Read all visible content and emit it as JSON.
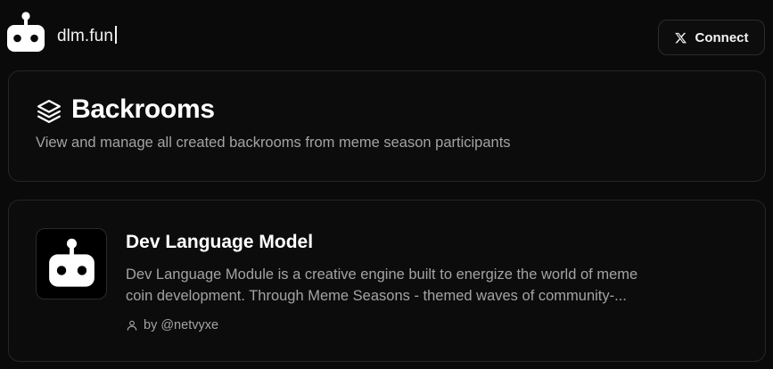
{
  "header": {
    "site_name": "dlm.fun",
    "connect_label": "Connect",
    "connect_icon": "x-logo-icon",
    "logo_icon": "robot-icon"
  },
  "page": {
    "title": "Backrooms",
    "title_icon": "layers-icon",
    "subtitle": "View and manage all created backrooms from meme season participants"
  },
  "backrooms": [
    {
      "title": "Dev Language Model",
      "avatar_icon": "robot-icon",
      "description_lines": [
        "Dev Language Module is a creative engine built to energize the world of meme",
        "coin development. Through Meme Seasons - themed waves of community-..."
      ],
      "author": "by @netvyxe",
      "author_icon": "user-icon"
    }
  ],
  "colors": {
    "background": "#0a0a0a",
    "card_background": "#0c0c0c",
    "card_border": "#262626",
    "text_primary": "#ffffff",
    "text_muted": "#a3a3a3"
  }
}
